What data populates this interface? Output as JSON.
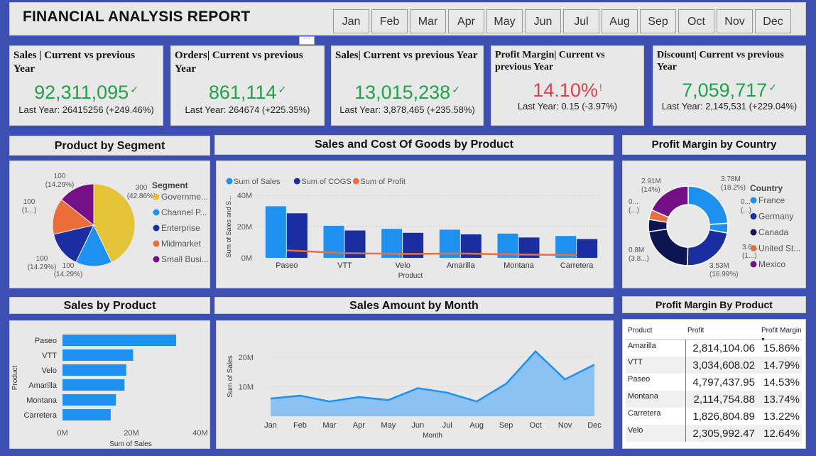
{
  "report_title": "FINANCIAL ANALYSIS REPORT",
  "more_icon": "ellipsis-icon",
  "months": [
    "Jan",
    "Feb",
    "Mar",
    "Apr",
    "May",
    "Jun",
    "Jul",
    "Aug",
    "Sep",
    "Oct",
    "Nov",
    "Dec"
  ],
  "kpis": [
    {
      "title": "Sales | Current vs previous Year",
      "value": "92,311,095",
      "status": "check",
      "sub": "Last Year: 26415256 (+249.46%)"
    },
    {
      "title": "Orders| Current vs previous Year",
      "value": "861,114",
      "status": "check",
      "sub": "Last Year: 264674 (+225.35%)"
    },
    {
      "title": "Sales| Current vs previous Year",
      "value": "13,015,238",
      "status": "check",
      "sub": "Last Year: 3,878,465 (+235.58%)"
    },
    {
      "title": "Profit Margin| Current vs previous Year",
      "value": "14.10%",
      "status": "warning",
      "sub": "Last Year: 0.15 (-3.97%)"
    },
    {
      "title": "Discount| Current vs previous Year",
      "value": "7,059,717",
      "status": "check",
      "sub": "Last Year: 2,145,531 (+229.04%)"
    }
  ],
  "colors": {
    "good": "#1fa34a",
    "bad": "#d9424b",
    "page_bg": "#3d4fb0",
    "panel_bg": "#e8e8e8"
  },
  "headers": {
    "segment": "Product by Segment",
    "sales_cogs": "Sales and Cost Of Goods  by Product",
    "profit_country": "Profit Margin by Country",
    "sales_product": "Sales by Product",
    "sales_month": "Sales Amount by Month",
    "profit_product": "Profit Margin By Product"
  },
  "chart_data": [
    {
      "id": "segment",
      "type": "pie",
      "legend_title": "Segment",
      "legend_position": "right",
      "slices": [
        {
          "name": "Governme...",
          "value": 300,
          "label_top": "300",
          "label_bottom": "(42.86%)",
          "color": "#e5c336"
        },
        {
          "name": "Channel P...",
          "value": 100,
          "label_top": "100",
          "label_bottom": "(14.29%)",
          "color": "#1e90f0"
        },
        {
          "name": "Enterprise",
          "value": 100,
          "label_top": "100",
          "label_bottom": "(14.29%)",
          "color": "#1a2ea1"
        },
        {
          "name": "Midmarket",
          "value": 100,
          "label_top": "100",
          "label_bottom": "(1...)",
          "color": "#ea6e39"
        },
        {
          "name": "Small Busi...",
          "value": 100,
          "label_top": "100",
          "label_bottom": "(14.29%)",
          "color": "#740f86"
        }
      ]
    },
    {
      "id": "sales_cogs",
      "type": "bar",
      "legend_position": "top-left",
      "categories": [
        "Paseo",
        "VTT",
        "Velo",
        "Amarilla",
        "Montana",
        "Carretera"
      ],
      "series": [
        {
          "name": "Sum of  Sales",
          "kind": "bar",
          "color": "#1e90f0",
          "values": [
            33,
            20.5,
            18.5,
            18,
            15.5,
            14
          ]
        },
        {
          "name": "Sum of COGS",
          "kind": "bar",
          "color": "#1a2ea1",
          "values": [
            28.5,
            17.5,
            16,
            15,
            13,
            12
          ]
        },
        {
          "name": "Sum of Profit",
          "kind": "line",
          "color": "#e9703d",
          "values": [
            4.8,
            3,
            2.5,
            2.8,
            2.1,
            1.8
          ]
        }
      ],
      "xlabel": "Product",
      "ylabel": "Sum of Sales and S...",
      "yticks": [
        "0M",
        "20M",
        "40M"
      ],
      "ylim": [
        0,
        40
      ]
    },
    {
      "id": "country",
      "type": "pie",
      "donut": true,
      "legend_title": "Country",
      "legend_position": "right",
      "slices": [
        {
          "name": "France",
          "value": 18.2,
          "color": "#1e90f0"
        },
        {
          "name": "Germany",
          "value": 17.0,
          "color": "#1a2ea1"
        },
        {
          "name": "Canada",
          "value": 16.99,
          "color": "#0d1552"
        },
        {
          "name": "United St...",
          "value": 14.0,
          "color": "#ea6e39"
        },
        {
          "name": "Mexico",
          "value": 14.0,
          "color": "#740f86"
        }
      ],
      "labels": [
        {
          "line1": "3.78M",
          "line2": "(18.2%)"
        },
        {
          "line1": "0...",
          "line2": "(...)"
        },
        {
          "line1": "3.6...",
          "line2": "(1...)"
        },
        {
          "line1": "3.53M",
          "line2": "(16.99%)"
        },
        {
          "line1": "0.8M",
          "line2": "(3.8...)"
        },
        {
          "line1": "0...",
          "line2": "(...)"
        },
        {
          "line1": "2.91M",
          "line2": "(14%)"
        }
      ]
    },
    {
      "id": "sales_product",
      "type": "bar",
      "orientation": "horizontal",
      "categories": [
        "Paseo",
        "VTT",
        "Velo",
        "Amarilla",
        "Montana",
        "Carretera"
      ],
      "values": [
        33,
        20.5,
        18.5,
        18,
        15.5,
        14
      ],
      "color": "#1e90f0",
      "xlabel": "Sum of Sales",
      "ylabel": "Product",
      "xticks": [
        "0M",
        "20M",
        "40M"
      ],
      "xlim": [
        0,
        40
      ]
    },
    {
      "id": "sales_month",
      "type": "area",
      "x": [
        "Jan",
        "Feb",
        "Mar",
        "Apr",
        "May",
        "Jun",
        "Jul",
        "Aug",
        "Sep",
        "Oct",
        "Nov",
        "Dec"
      ],
      "values": [
        6,
        7,
        5,
        6.5,
        5.5,
        9.5,
        8,
        5,
        11,
        22,
        12.5,
        17.5
      ],
      "color": "#1e90f0",
      "xlabel": "Month",
      "ylabel": "Sum of Sales",
      "yticks": [
        "10M",
        "20M"
      ],
      "ylim": [
        0,
        25
      ]
    },
    {
      "id": "profit_product",
      "type": "table",
      "columns": [
        "Product",
        "Profit",
        "Profit Margin"
      ],
      "rows": [
        [
          "Amarilla",
          "2,814,104.06",
          "15.86%"
        ],
        [
          "VTT",
          "3,034,608.02",
          "14.79%"
        ],
        [
          "Paseo",
          "4,797,437.95",
          "14.53%"
        ],
        [
          "Montana",
          "2,114,754.88",
          "13.74%"
        ],
        [
          "Carretera",
          "1,826,804.89",
          "13.22%"
        ],
        [
          "Velo",
          "2,305,992.47",
          "12.64%"
        ]
      ]
    }
  ]
}
